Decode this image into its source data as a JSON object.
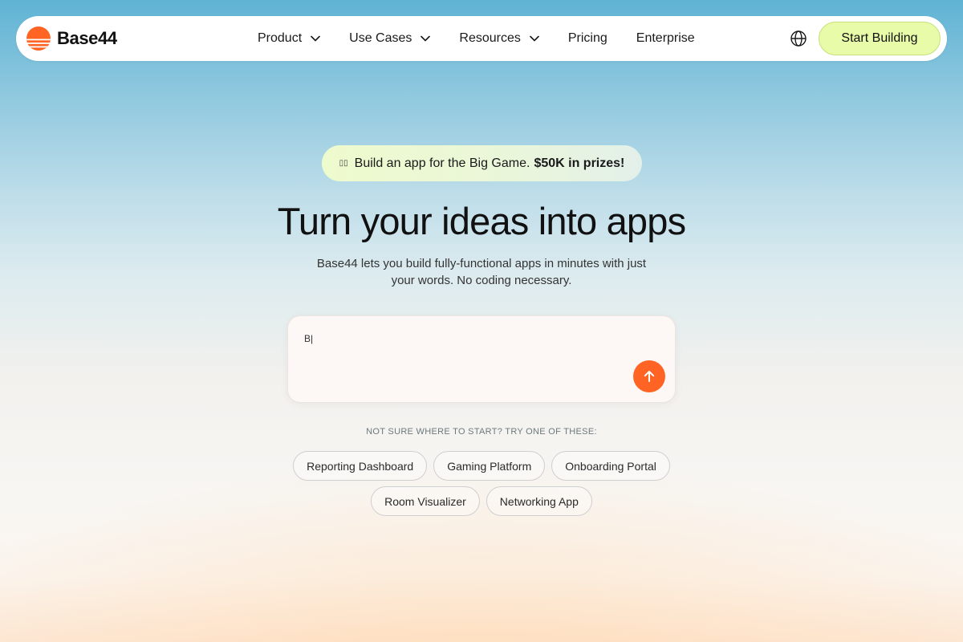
{
  "brand": {
    "name": "Base44",
    "accent_color": "#ff6424",
    "logo_icon": "sunset-logo-icon"
  },
  "nav": {
    "items": [
      {
        "label": "Product",
        "has_dropdown": true
      },
      {
        "label": "Use Cases",
        "has_dropdown": true
      },
      {
        "label": "Resources",
        "has_dropdown": true
      },
      {
        "label": "Pricing",
        "has_dropdown": false
      },
      {
        "label": "Enterprise",
        "has_dropdown": false
      }
    ],
    "language_icon": "globe-icon",
    "cta_label": "Start Building",
    "cta_color": "#e8fba8"
  },
  "promo": {
    "icon": "▯▯",
    "text": "Build an app for the Big Game.",
    "highlight": "$50K in prizes!"
  },
  "hero": {
    "title": "Turn your ideas into apps",
    "subtitle": "Base44 lets you build fully-functional apps in minutes with just your words. No coding necessary."
  },
  "prompt": {
    "value": "B|",
    "send_icon": "arrow-up-icon"
  },
  "suggestions": {
    "label": "NOT SURE WHERE TO START? TRY ONE OF THESE:",
    "row1": [
      "Reporting Dashboard",
      "Gaming Platform",
      "Onboarding Portal"
    ],
    "row2": [
      "Room Visualizer",
      "Networking App"
    ]
  }
}
